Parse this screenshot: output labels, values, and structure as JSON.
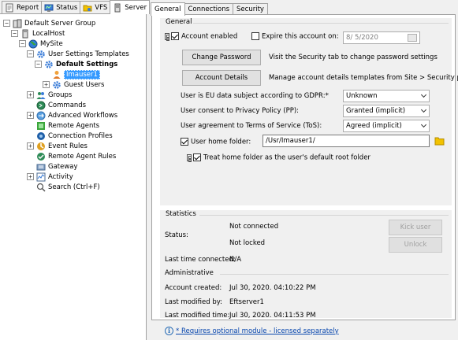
{
  "left_tabs": [
    {
      "label": "Report",
      "icon": "report-icon"
    },
    {
      "label": "Status",
      "icon": "status-icon"
    },
    {
      "label": "VFS",
      "icon": "vfs-icon"
    },
    {
      "label": "Server",
      "icon": "server-icon"
    }
  ],
  "tree": {
    "root": "Default Server Group",
    "localhost": "LocalHost",
    "mysite": "MySite",
    "user_settings_templates": "User Settings Templates",
    "default_settings": "Default Settings",
    "user": "Imauser1",
    "guest_users": "Guest Users",
    "groups": "Groups",
    "commands": "Commands",
    "advanced_workflows": "Advanced Workflows",
    "remote_agents": "Remote Agents",
    "connection_profiles": "Connection Profiles",
    "event_rules": "Event Rules",
    "remote_agent_rules": "Remote Agent Rules",
    "gateway": "Gateway",
    "activity": "Activity",
    "search": "Search (Ctrl+F)"
  },
  "right_tabs": [
    "General",
    "Connections",
    "Security"
  ],
  "general": {
    "title": "General",
    "account_enabled": "Account enabled",
    "expire_label": "Expire this account on:",
    "expire_date": "8/ 5/2020",
    "change_password_btn": "Change Password",
    "change_password_hint": "Visit the Security tab to change password settings",
    "account_details_btn": "Account Details",
    "account_details_hint": "Manage account details templates from Site > Security page",
    "gdpr_label": "User is EU data subject according to GDPR:*",
    "gdpr_value": "Unknown",
    "privacy_label": "User consent to Privacy Policy (PP):",
    "privacy_value": "Granted (implicit)",
    "tos_label": "User agreement to Terms of Service (ToS):",
    "tos_value": "Agreed (implicit)",
    "home_folder_label": "User home folder:",
    "home_folder_value": "/Usr/Imauser1/",
    "treat_home_label": "Treat home folder as the user's default root folder"
  },
  "statistics": {
    "title": "Statistics",
    "status_label": "Status:",
    "status_connected": "Not connected",
    "status_locked": "Not locked",
    "kick_btn": "Kick user",
    "unlock_btn": "Unlock",
    "last_connected_label": "Last time connected:",
    "last_connected_value": "N/A",
    "admin_title": "Administrative",
    "created_label": "Account created:",
    "created_value": "Jul 30, 2020. 04:10:22 PM",
    "modified_by_label": "Last modified by:",
    "modified_by_value": "Eftserver1",
    "modified_time_label": "Last modified time:",
    "modified_time_value": "Jul 30, 2020. 04:11:53 PM"
  },
  "footer": {
    "note": "* Requires optional module - licensed separately"
  },
  "colors": {
    "selection": "#3399ff",
    "link": "#0645ad",
    "folder": "#f2c200"
  }
}
